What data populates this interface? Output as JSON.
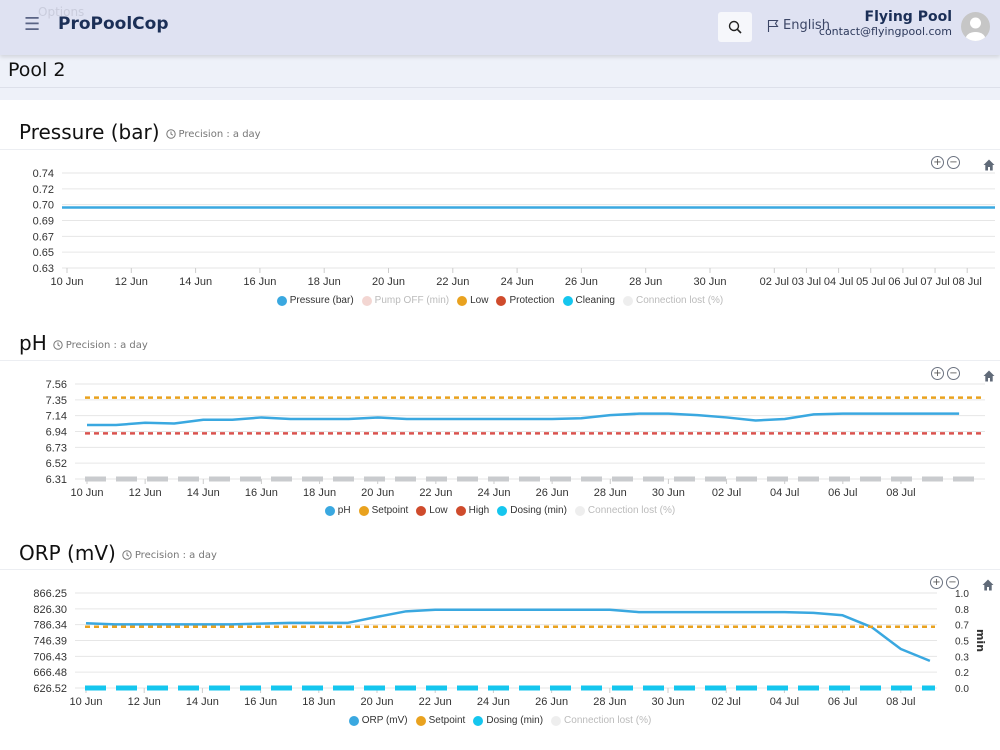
{
  "header": {
    "options_label": "Options",
    "brand": "ProPoolCop",
    "language": "English",
    "user_name": "Flying Pool",
    "user_email": "contact@flyingpool.com"
  },
  "page": {
    "title": "Pool 2"
  },
  "charts": [
    {
      "title": "Pressure (bar)",
      "precision": "Precision : a day",
      "chart_data": {
        "type": "line",
        "x_start": "10 Jun",
        "x_ticks": [
          "10 Jun",
          "12 Jun",
          "14 Jun",
          "16 Jun",
          "18 Jun",
          "20 Jun",
          "22 Jun",
          "24 Jun",
          "26 Jun",
          "28 Jun",
          "30 Jun",
          "02 Jul",
          "03 Jul",
          "04 Jul",
          "05 Jul",
          "06 Jul",
          "07 Jul",
          "08 Jul"
        ],
        "x_tick_days": [
          0,
          2,
          4,
          6,
          8,
          10,
          12,
          14,
          16,
          18,
          20,
          22,
          23,
          24,
          25,
          26,
          27,
          28
        ],
        "y_ticks": [
          "0.74",
          "0.72",
          "0.70",
          "0.69",
          "0.67",
          "0.65",
          "0.63"
        ],
        "ylim": [
          0.63,
          0.74
        ],
        "series": [
          {
            "name": "Pressure (bar)",
            "color": "#3aa8e0",
            "style": "solid",
            "values": [
              0.7,
              0.7,
              0.7,
              0.7,
              0.7,
              0.7,
              0.7,
              0.7,
              0.7,
              0.7,
              0.7,
              0.7,
              0.7,
              0.7,
              0.7,
              0.7,
              0.7,
              0.7,
              0.7,
              0.7,
              0.7,
              0.7,
              0.7,
              0.7,
              0.7,
              0.7,
              0.7,
              0.7,
              0.7,
              0.7
            ]
          }
        ],
        "legend": [
          {
            "name": "Pressure (bar)",
            "color": "#3aa8e0",
            "active": true
          },
          {
            "name": "Pump OFF (min)",
            "color": "#f3d6d2",
            "active": false
          },
          {
            "name": "Low",
            "color": "#e9a21f",
            "active": true
          },
          {
            "name": "Protection",
            "color": "#cf4b2c",
            "active": true
          },
          {
            "name": "Cleaning",
            "color": "#15c6ee",
            "active": true
          },
          {
            "name": "Connection lost (%)",
            "color": "#eeeeee",
            "active": false
          }
        ]
      }
    },
    {
      "title": "pH",
      "precision": "Precision : a day",
      "chart_data": {
        "type": "line",
        "x_start": "10 Jun",
        "x_ticks": [
          "10 Jun",
          "12 Jun",
          "14 Jun",
          "16 Jun",
          "18 Jun",
          "20 Jun",
          "22 Jun",
          "24 Jun",
          "26 Jun",
          "28 Jun",
          "30 Jun",
          "02 Jul",
          "04 Jul",
          "06 Jul",
          "08 Jul"
        ],
        "x_tick_days": [
          0,
          2,
          4,
          6,
          8,
          10,
          12,
          14,
          16,
          18,
          20,
          22,
          24,
          26,
          28
        ],
        "y_ticks": [
          "7.56",
          "7.35",
          "7.14",
          "6.94",
          "6.73",
          "6.52",
          "6.31"
        ],
        "ylim": [
          6.31,
          7.56
        ],
        "series": [
          {
            "name": "pH",
            "color": "#3aa8e0",
            "style": "solid",
            "values": [
              7.02,
              7.02,
              7.05,
              7.04,
              7.09,
              7.09,
              7.12,
              7.1,
              7.1,
              7.1,
              7.12,
              7.1,
              7.1,
              7.1,
              7.1,
              7.1,
              7.1,
              7.11,
              7.15,
              7.17,
              7.17,
              7.15,
              7.12,
              7.08,
              7.1,
              7.16,
              7.17,
              7.17,
              7.17,
              7.17,
              7.17
            ]
          },
          {
            "name": "Setpoint",
            "color": "#e9a21f",
            "style": "dash",
            "values": [
              7.38,
              7.38
            ]
          },
          {
            "name": "Low",
            "color": "#d9534f",
            "style": "dash",
            "values": [
              6.91,
              6.91
            ]
          },
          {
            "name": "Connection lost (%)",
            "color": "#c9cbce",
            "style": "wide",
            "values": [
              6.31,
              6.31
            ]
          }
        ],
        "legend": [
          {
            "name": "pH",
            "color": "#3aa8e0",
            "active": true
          },
          {
            "name": "Setpoint",
            "color": "#e9a21f",
            "active": true
          },
          {
            "name": "Low",
            "color": "#cf4b2c",
            "active": true
          },
          {
            "name": "High",
            "color": "#cf4b2c",
            "active": true
          },
          {
            "name": "Dosing (min)",
            "color": "#15c6ee",
            "active": true
          },
          {
            "name": "Connection lost (%)",
            "color": "#eeeeee",
            "active": false
          }
        ]
      }
    },
    {
      "title": "ORP (mV)",
      "precision": "Precision : a day",
      "chart_data": {
        "type": "line",
        "x_start": "10 Jun",
        "x_ticks": [
          "10 Jun",
          "12 Jun",
          "14 Jun",
          "16 Jun",
          "18 Jun",
          "20 Jun",
          "22 Jun",
          "24 Jun",
          "26 Jun",
          "28 Jun",
          "30 Jun",
          "02 Jul",
          "04 Jul",
          "06 Jul",
          "08 Jul"
        ],
        "x_tick_days": [
          0,
          2,
          4,
          6,
          8,
          10,
          12,
          14,
          16,
          18,
          20,
          22,
          24,
          26,
          28
        ],
        "y_ticks": [
          "866.25",
          "826.30",
          "786.34",
          "746.39",
          "706.43",
          "666.48",
          "626.52"
        ],
        "ylim": [
          626.52,
          866.25
        ],
        "y2_ticks": [
          "1.0",
          "0.8",
          "0.7",
          "0.5",
          "0.3",
          "0.2",
          "0.0"
        ],
        "y2_label": "min",
        "series": [
          {
            "name": "ORP (mV)",
            "color": "#3aa8e0",
            "style": "solid",
            "values": [
              790,
              787,
              787,
              787,
              787,
              787,
              789,
              791,
              791,
              791,
              806,
              820,
              824,
              824,
              824,
              824,
              824,
              824,
              824,
              818,
              818,
              818,
              818,
              818,
              818,
              816,
              810,
              780,
              725,
              695
            ]
          },
          {
            "name": "Setpoint",
            "color": "#e9a21f",
            "style": "dash",
            "values": [
              781,
              781
            ]
          },
          {
            "name": "Dosing (min)",
            "color": "#15c6ee",
            "style": "wide",
            "values": [
              626.52,
              626.52
            ]
          }
        ],
        "legend": [
          {
            "name": "ORP (mV)",
            "color": "#3aa8e0",
            "active": true
          },
          {
            "name": "Setpoint",
            "color": "#e9a21f",
            "active": true
          },
          {
            "name": "Dosing (min)",
            "color": "#15c6ee",
            "active": true
          },
          {
            "name": "Connection lost (%)",
            "color": "#eeeeee",
            "active": false
          }
        ]
      }
    }
  ]
}
